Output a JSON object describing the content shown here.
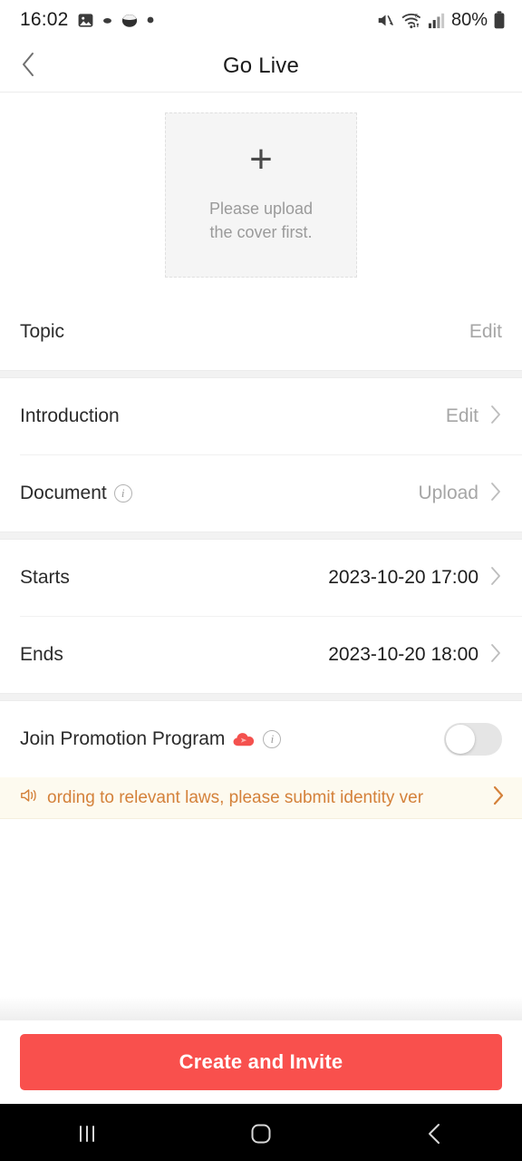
{
  "status_bar": {
    "time": "16:02",
    "battery_percent": "80%",
    "left_icons": [
      "photo-icon",
      "notification-dot-icon",
      "app-circle-icon",
      "dot-icon"
    ],
    "right_icons": [
      "mute-icon",
      "wifi-icon",
      "cellular-signal-icon",
      "battery-icon"
    ]
  },
  "header": {
    "title": "Go Live",
    "back_icon": "chevron-left-icon"
  },
  "cover": {
    "plus_icon": "plus-icon",
    "hint_line1": "Please upload",
    "hint_line2": "the cover first."
  },
  "rows": [
    {
      "label": "Topic",
      "action": "Edit",
      "chevron": false,
      "info": false
    },
    {
      "label": "Introduction",
      "action": "Edit",
      "chevron": true,
      "info": false
    },
    {
      "label": "Document",
      "action": "Upload",
      "chevron": true,
      "info": true
    },
    {
      "label": "Starts",
      "value": "2023-10-20 17:00",
      "chevron": true
    },
    {
      "label": "Ends",
      "value": "2023-10-20 18:00",
      "chevron": true
    }
  ],
  "promotion": {
    "label": "Join Promotion Program",
    "badge_icon": "promo-cloud-icon",
    "info_icon": "info-icon",
    "toggle_state": "off"
  },
  "notice": {
    "speaker_icon": "speaker-icon",
    "text": "ording to relevant laws, please submit identity ver",
    "chevron_icon": "chevron-right-icon"
  },
  "cta": {
    "label": "Create and Invite"
  },
  "nav_bar": {
    "recents_icon": "recents-icon",
    "home_icon": "home-icon",
    "back_icon": "back-icon"
  },
  "colors": {
    "accent": "#f9504d",
    "notice_bg": "#fdfaef",
    "notice_text": "#d4813a",
    "cover_bg": "#f5f5f5",
    "muted_text": "#a6a6a6"
  }
}
